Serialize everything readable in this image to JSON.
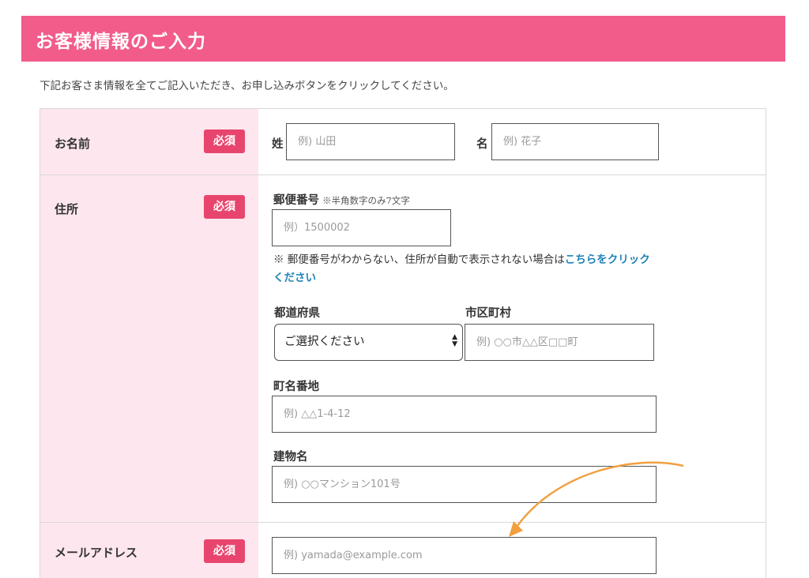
{
  "header": {
    "title": "お客様情報のご入力"
  },
  "intro": "下記お客さま情報を全てご記入いただき、お申し込みボタンをクリックしてください。",
  "name_row": {
    "label": "お名前",
    "required": "必須",
    "last_label": "姓",
    "last_placeholder": "例) 山田",
    "first_label": "名",
    "first_placeholder": "例) 花子"
  },
  "address_row": {
    "label": "住所",
    "required": "必須",
    "postal_label": "郵便番号",
    "postal_note": "※半角数字のみ7文字",
    "postal_placeholder": "例）1500002",
    "help_text": "※ 郵便番号がわからない、住所が自動で表示されない場合は",
    "help_link": "こちらをクリックください",
    "prefecture_label": "都道府県",
    "prefecture_value": "ご選択ください",
    "city_label": "市区町村",
    "city_placeholder": "例) ○○市△△区□□町",
    "street_label": "町名番地",
    "street_placeholder": "例) △△1-4-12",
    "building_label": "建物名",
    "building_placeholder": "例) ○○マンション101号"
  },
  "email_row": {
    "label": "メールアドレス",
    "required": "必須",
    "placeholder": "例) yamada@example.com"
  },
  "colors": {
    "header_bg": "#f25c8a",
    "label_bg": "#fde6ee",
    "required_bg": "#e8456e",
    "link": "#1f82b6",
    "annotation_arrow": "#f0a040"
  },
  "icons": {
    "select_arrows": "updown-arrows-icon",
    "annotation": "curved-arrow-icon"
  }
}
